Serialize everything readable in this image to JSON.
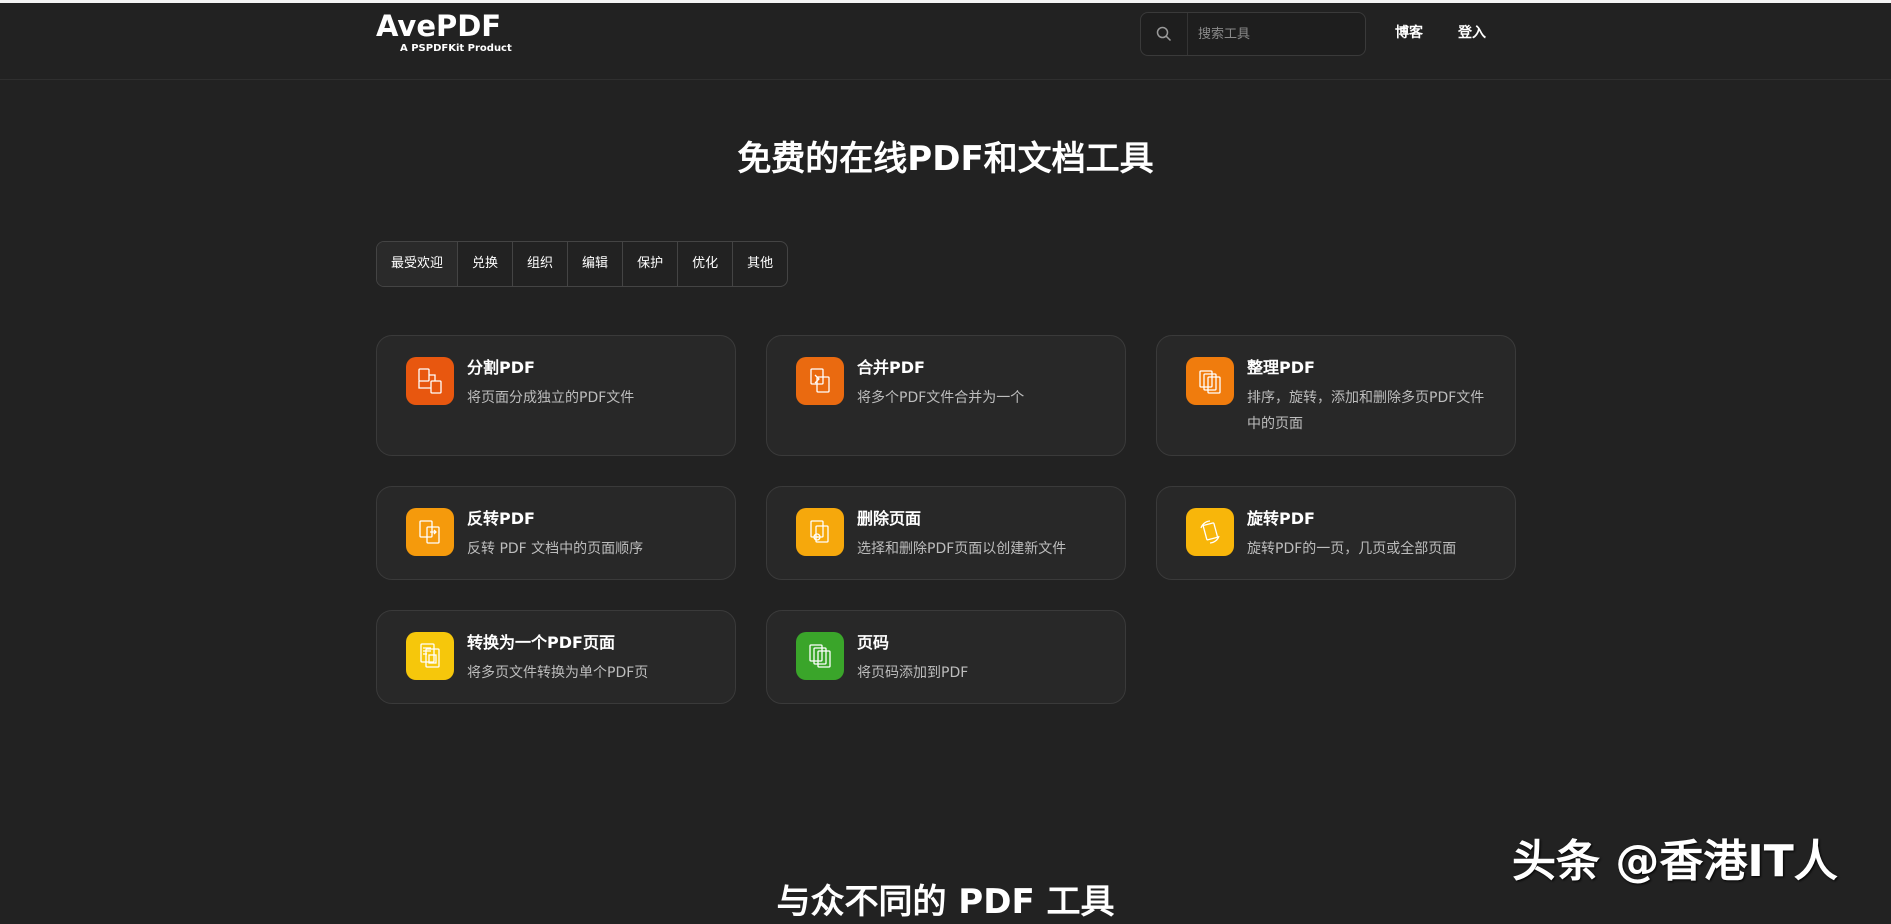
{
  "header": {
    "logo_main": "AvePDF",
    "logo_sub": "A PSPDFKit Product",
    "search_placeholder": "搜索工具",
    "nav_blog": "博客",
    "nav_login": "登入"
  },
  "hero": {
    "title": "免费的在线PDF和文档工具"
  },
  "tabs": [
    "最受欢迎",
    "兑换",
    "组织",
    "编辑",
    "保护",
    "优化",
    "其他"
  ],
  "cards": [
    {
      "title": "分割PDF",
      "desc": "将页面分成独立的PDF文件",
      "color": "#e8570f",
      "icon": "split-pdf-icon"
    },
    {
      "title": "合并PDF",
      "desc": "将多个PDF文件合并为一个",
      "color": "#ea6a10",
      "icon": "merge-pdf-icon"
    },
    {
      "title": "整理PDF",
      "desc": "排序，旋转，添加和删除多页PDF文件中的页面",
      "color": "#f07c0d",
      "icon": "organize-pdf-icon"
    },
    {
      "title": "反转PDF",
      "desc": "反转 PDF 文档中的页面顺序",
      "color": "#f59a0c",
      "icon": "reverse-pdf-icon"
    },
    {
      "title": "删除页面",
      "desc": "选择和删除PDF页面以创建新文件",
      "color": "#f6a80c",
      "icon": "delete-pages-icon"
    },
    {
      "title": "旋转PDF",
      "desc": "旋转PDF的一页，几页或全部页面",
      "color": "#f8b60a",
      "icon": "rotate-pdf-icon"
    },
    {
      "title": "转换为一个PDF页面",
      "desc": "将多页文件转换为单个PDF页",
      "color": "#f6c70b",
      "icon": "one-page-pdf-icon"
    },
    {
      "title": "页码",
      "desc": "将页码添加到PDF",
      "color": "#3aa52a",
      "icon": "page-numbers-icon"
    }
  ],
  "section2": {
    "title": "与众不同的 PDF 工具"
  },
  "watermark": "头条 @香港IT人"
}
